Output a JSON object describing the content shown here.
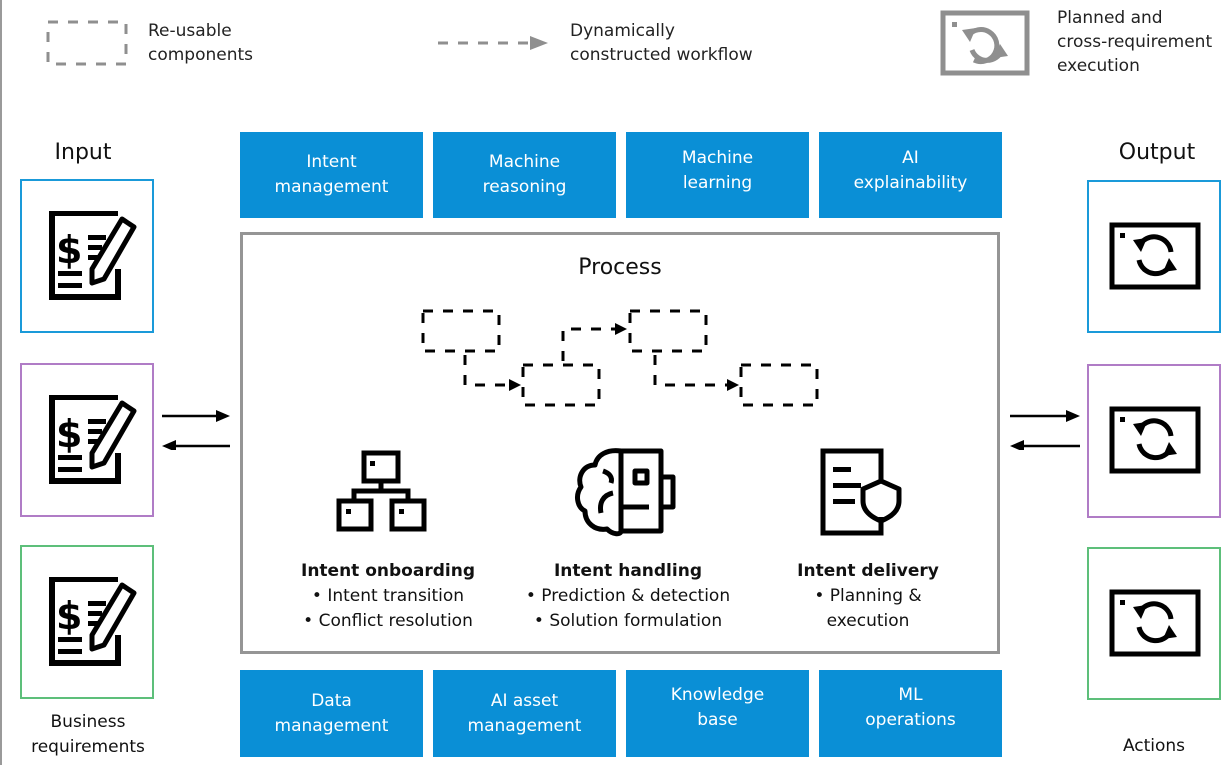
{
  "legend": {
    "reusable": "Re-usable\ncomponents",
    "reusable_l1": "Re-usable",
    "reusable_l2": "components",
    "workflow_l1": "Dynamically",
    "workflow_l2": "constructed workflow",
    "planned_l1": "Planned and",
    "planned_l2": "cross-requirement",
    "planned_l3": "execution"
  },
  "input": {
    "title": "Input",
    "caption_l1": "Business",
    "caption_l2": "requirements",
    "frames": [
      {
        "color": "#1a9ad9",
        "icon": "document-dollar-pen-icon"
      },
      {
        "color": "#b07cc6",
        "icon": "document-dollar-pen-icon"
      },
      {
        "color": "#5dbf7a",
        "icon": "document-dollar-pen-icon"
      }
    ]
  },
  "output": {
    "title": "Output",
    "caption": "Actions",
    "frames": [
      {
        "color": "#1a9ad9",
        "icon": "window-refresh-icon"
      },
      {
        "color": "#b07cc6",
        "icon": "window-refresh-icon"
      },
      {
        "color": "#5dbf7a",
        "icon": "window-refresh-icon"
      }
    ]
  },
  "top_tiles": [
    {
      "l1": "Intent",
      "l2": "management"
    },
    {
      "l1": "Machine",
      "l2": "reasoning"
    },
    {
      "l1": "Machine",
      "l2": "learning"
    },
    {
      "l1": "AI",
      "l2": "explainability"
    }
  ],
  "bottom_tiles": [
    {
      "l1": "Data",
      "l2": "management"
    },
    {
      "l1": "AI asset",
      "l2": "management"
    },
    {
      "l1": "Knowledge",
      "l2": "base"
    },
    {
      "l1": "ML",
      "l2": "operations"
    }
  ],
  "process": {
    "title": "Process",
    "stages": [
      {
        "heading": "Intent onboarding",
        "items": [
          "• Intent transition",
          "• Conflict resolution"
        ],
        "icon": "hierarchy-icon"
      },
      {
        "heading": "Intent handling",
        "items": [
          "• Prediction & detection",
          "• Solution formulation"
        ],
        "icon": "brain-robot-icon"
      },
      {
        "heading": "Intent delivery",
        "items": [
          "• Planning &",
          "execution"
        ],
        "icon": "document-shield-icon"
      }
    ]
  },
  "colors": {
    "tile_blue": "#0a8fd6",
    "frame_blue": "#1a9ad9",
    "frame_purple": "#b07cc6",
    "frame_green": "#5dbf7a",
    "legend_gray": "#8f8f8f",
    "process_border": "#959595"
  }
}
